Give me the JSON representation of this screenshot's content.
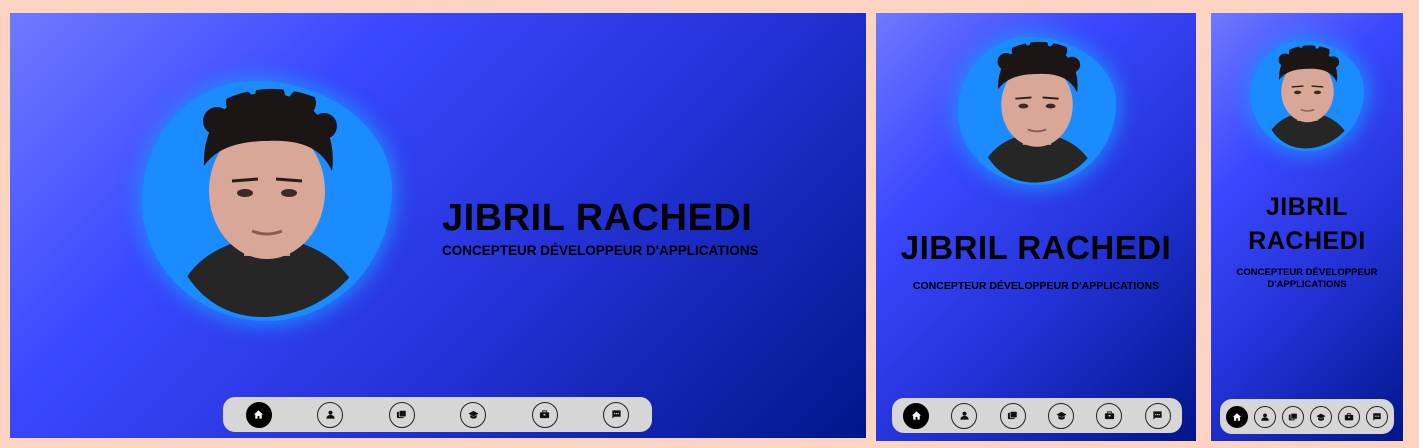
{
  "profile": {
    "name": "JIBRIL RACHEDI",
    "subtitle": "CONCEPTEUR DÉVELOPPEUR D'APPLICATIONS",
    "subtitle_line1": "CONCEPTEUR DÉVELOPPEUR",
    "subtitle_line2": "D'APPLICATIONS",
    "name_line1": "JIBRIL",
    "name_line2": "RACHEDI"
  },
  "nav": {
    "items": [
      {
        "icon": "home-icon",
        "active": true
      },
      {
        "icon": "user-icon",
        "active": false
      },
      {
        "icon": "folders-icon",
        "active": false
      },
      {
        "icon": "graduation-cap-icon",
        "active": false
      },
      {
        "icon": "briefcase-icon",
        "active": false
      },
      {
        "icon": "message-icon",
        "active": false
      }
    ]
  },
  "colors": {
    "page_background": "#fdd3c2",
    "gradient_start": "#6f79ff",
    "gradient_end": "#00168a",
    "avatar_blob": "#1a8cff",
    "nav_background": "#d6d6d6",
    "active_nav": "#000000"
  }
}
